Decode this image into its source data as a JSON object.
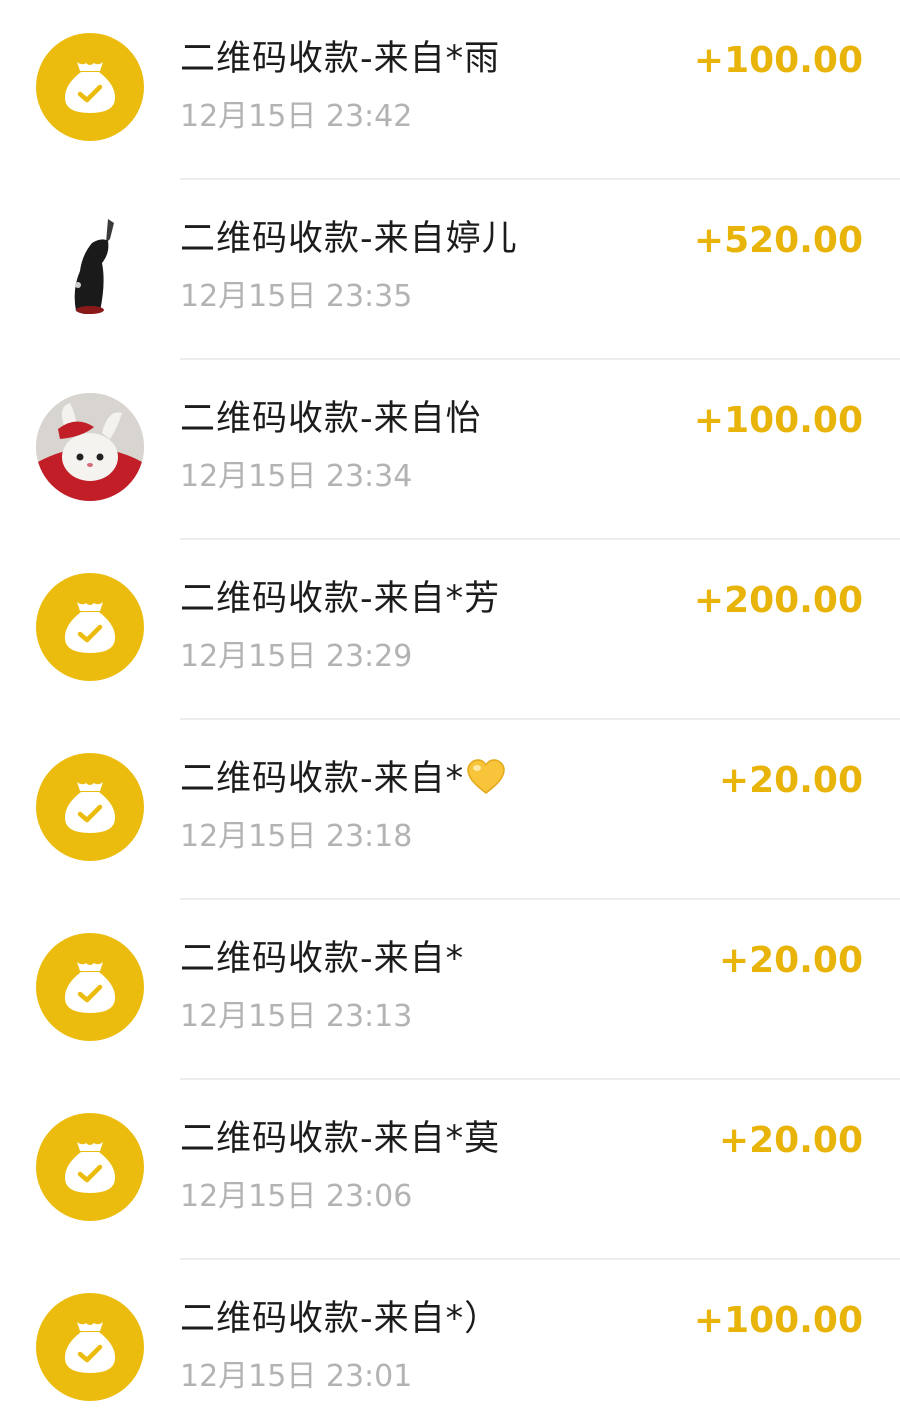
{
  "colors": {
    "accent": "#E8B40A",
    "icon_bg": "#EBBC0E",
    "title_text": "#1c1c1c",
    "time_text": "#b3b3b3",
    "divider": "#ececec"
  },
  "transactions": [
    {
      "title": "二维码收款-来自*雨",
      "time": "12月15日 23:42",
      "amount": "+100.00",
      "avatar": "money-bag-icon"
    },
    {
      "title": "二维码收款-来自婷儿",
      "time": "12月15日 23:35",
      "amount": "+520.00",
      "avatar": "user-photo"
    },
    {
      "title": "二维码收款-来自怡",
      "time": "12月15日 23:34",
      "amount": "+100.00",
      "avatar": "user-photo"
    },
    {
      "title": "二维码收款-来自*芳",
      "time": "12月15日 23:29",
      "amount": "+200.00",
      "avatar": "money-bag-icon"
    },
    {
      "title": "二维码收款-来自*",
      "time": "12月15日 23:18",
      "amount": "+20.00",
      "avatar": "money-bag-icon",
      "title_suffix_icon": "yellow-heart-icon"
    },
    {
      "title": "二维码收款-来自*",
      "time": "12月15日 23:13",
      "amount": "+20.00",
      "avatar": "money-bag-icon"
    },
    {
      "title": "二维码收款-来自*莫",
      "time": "12月15日 23:06",
      "amount": "+20.00",
      "avatar": "money-bag-icon"
    },
    {
      "title": "二维码收款-来自*）",
      "time": "12月15日 23:01",
      "amount": "+100.00",
      "avatar": "money-bag-icon"
    }
  ]
}
